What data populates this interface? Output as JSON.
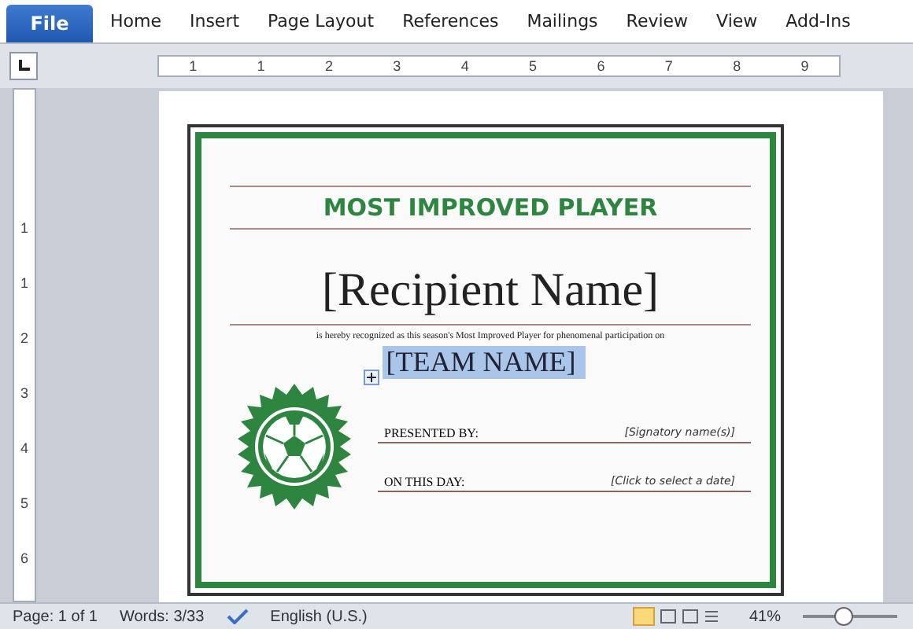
{
  "ribbon_tabs": [
    {
      "label": "File",
      "kind": "file"
    },
    {
      "label": "Home",
      "kind": "tab"
    },
    {
      "label": "Insert",
      "kind": "tab"
    },
    {
      "label": "Page Layout",
      "kind": "tab"
    },
    {
      "label": "References",
      "kind": "tab"
    },
    {
      "label": "Mailings",
      "kind": "tab"
    },
    {
      "label": "Review",
      "kind": "tab"
    },
    {
      "label": "View",
      "kind": "tab"
    },
    {
      "label": "Add-Ins",
      "kind": "tab"
    }
  ],
  "horizontal_ruler": {
    "labels": [
      "1",
      "1",
      "2",
      "3",
      "4",
      "5",
      "6",
      "7",
      "8",
      "9"
    ]
  },
  "vertical_ruler": {
    "labels": [
      "1",
      "1",
      "2",
      "3",
      "4",
      "5",
      "6"
    ]
  },
  "certificate": {
    "title": "MOST IMPROVED PLAYER",
    "recipient": "[Recipient Name]",
    "sentence": "is hereby recognized as this season's Most Improved Player for phenomenal participation on",
    "team": {
      "text": "[TEAM NAME]",
      "selected": true
    },
    "fields": [
      {
        "label": "PRESENTED BY:",
        "value": "[Signatory name(s)]"
      },
      {
        "label": "ON THIS DAY:",
        "value": "[Click to select a date]"
      }
    ]
  },
  "status_bar": {
    "page": "Page: 1 of 1",
    "words": "Words: 3/33",
    "language": "English (U.S.)",
    "zoom": "41%",
    "zoom_slider": {
      "level": 0.42
    }
  }
}
